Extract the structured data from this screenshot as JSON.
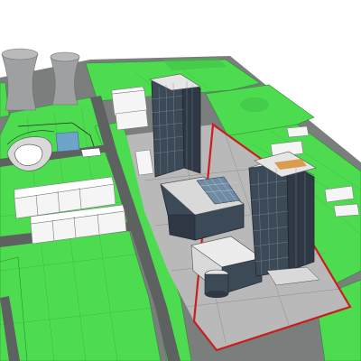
{
  "scene": {
    "colors": {
      "background": "#ffffff",
      "ground": "#7a7e7d",
      "lawn": "#4ddc50",
      "lawn_dark": "#3fc045",
      "lawn_grid": "#2e8c34",
      "road": "#5d6160",
      "plaza": "#b9b9ba",
      "plaza_line": "#8e8e90",
      "site_boundary": "#c81e1e",
      "glass": "#3c4a58",
      "glass_light": "#5c6e80",
      "roof": "#f2f2f2",
      "podium": "#d9d9da",
      "cooling_tower": "#9ea0a2",
      "water": "#6fa4c9",
      "building_white": "#f5f5f5",
      "accent": "#d98a2b"
    }
  }
}
